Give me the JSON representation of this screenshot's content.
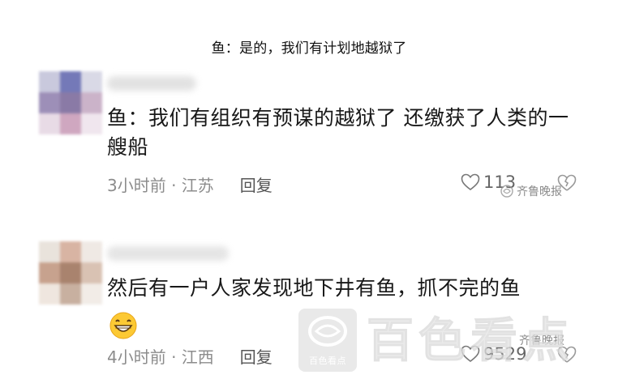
{
  "headline": "鱼：是的，我们有计划地越狱了",
  "comments": [
    {
      "text": "鱼：我们有组织有预谋的越狱了 还缴获了人类的一艘船",
      "time_location": "3小时前 · 江苏",
      "reply_label": "回复",
      "likes": "113"
    },
    {
      "text": "然后有一户人家发现地下井有鱼，抓不完的鱼",
      "time_location": "4小时前 · 江西",
      "reply_label": "回复",
      "likes": "9529"
    }
  ],
  "watermarks": {
    "small": "齐鲁晚报",
    "badge_text": "百色看点",
    "big_text": "百色看点"
  },
  "colors": {
    "meta_gray": "#8c8c8c",
    "text": "#181818",
    "watermark_gray": "#e3e3e3"
  }
}
